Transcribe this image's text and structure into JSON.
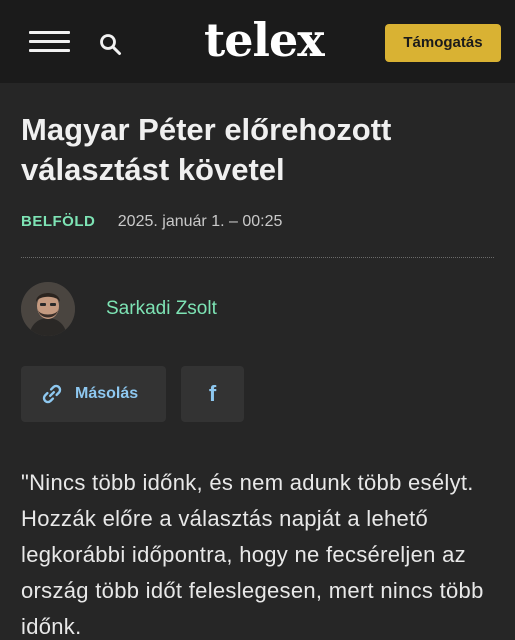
{
  "header": {
    "menu_icon": "hamburger-menu-icon",
    "search_icon": "search-icon",
    "logo": "telex",
    "support_label": "Támogatás",
    "support_color": "#d9b233"
  },
  "article": {
    "title": "Magyar Péter előrehozott választást követel",
    "category": "BELFÖLD",
    "date": "2025. január 1. – 00:25",
    "author": "Sarkadi Zsolt",
    "accent_color": "#7de3b4"
  },
  "share": {
    "copy_label": "Másolás",
    "copy_icon": "link-icon",
    "facebook_icon": "facebook-icon",
    "facebook_glyph": "f"
  },
  "body": {
    "paragraph": "\"Nincs több időnk, és nem adunk több esélyt. Hozzák előre a választás napját a lehető legkorábbi időpontra, hogy ne fecséreljen az ország több időt feleslegesen, mert nincs több időnk."
  }
}
